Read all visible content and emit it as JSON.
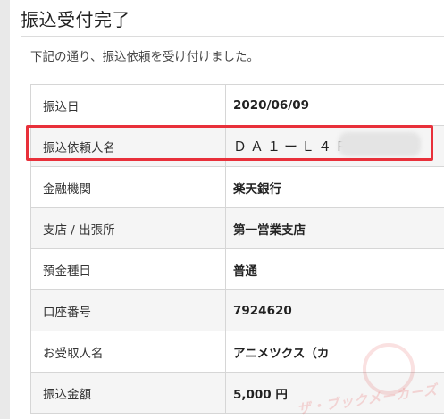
{
  "page": {
    "title": "振込受付完了",
    "description": "下記の通り、振込依頼を受け付けました。"
  },
  "details": [
    {
      "label": "振込日",
      "value": "2020/06/09"
    },
    {
      "label": "振込依頼人名",
      "value": "ＤＡ１ーＬ４ＰＷ"
    },
    {
      "label": "金融機関",
      "value": "楽天銀行"
    },
    {
      "label": "支店 / 出張所",
      "value": "第一営業支店"
    },
    {
      "label": "預金種目",
      "value": "普通"
    },
    {
      "label": "口座番号",
      "value": "7924620"
    },
    {
      "label": "お受取人名",
      "value": "アニメツクス（カ"
    },
    {
      "label": "振込金額",
      "value": "5,000 円"
    }
  ],
  "watermark": {
    "text": "ザ・ブックメーカーズ"
  },
  "colors": {
    "highlight": "#e8303a",
    "alt_row": "#f5f5f5",
    "border": "#d6d6d6"
  }
}
